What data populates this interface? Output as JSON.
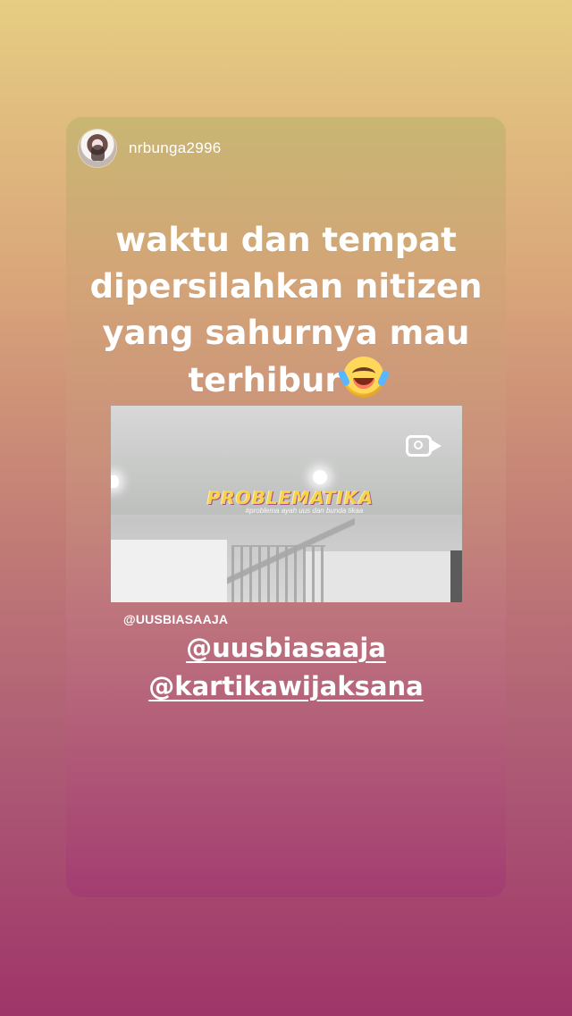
{
  "story": {
    "username": "nrbunga2996",
    "caption_lines": [
      "waktu dan tempat",
      "dipersilahkan nitizen",
      "yang sahurnya mau",
      "terhibur"
    ],
    "caption_emoji": "face with tears of joy",
    "video": {
      "logo": "PROBLEMATIKA",
      "logo_subtitle": "#problema ayah uus dan bunda tikaa",
      "icon": "camera-video-icon"
    },
    "small_tag": "@UUSBIASAAJA",
    "mentions": [
      "@uusbiasaaja",
      "@kartikawijaksana"
    ]
  },
  "colors": {
    "background_top": "#e6cd82",
    "background_bottom": "#9f3569",
    "text": "#ffffff",
    "logo": "#f7d24d"
  }
}
